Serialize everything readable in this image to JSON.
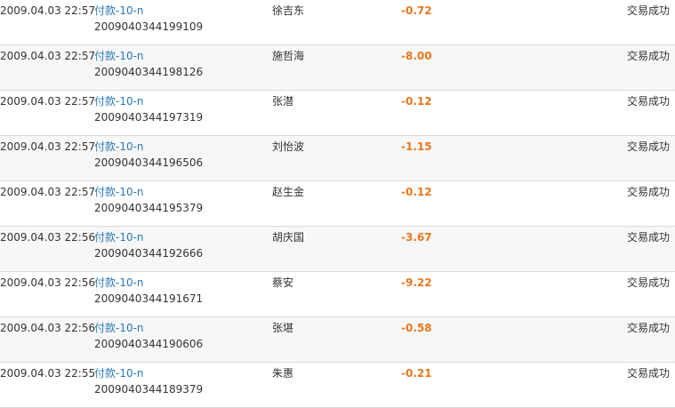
{
  "colors": {
    "link": "#2a79b4",
    "amount": "#e8771e",
    "row_alt_background": "#f7f7f7",
    "divider": "#d9d9d9"
  },
  "transactions": [
    {
      "time": "2009.04.03 22:57",
      "title": "付款-10-n",
      "serial": "2009040344199109",
      "name": "徐吉东",
      "amount": "-0.72",
      "status": "交易成功"
    },
    {
      "time": "2009.04.03 22:57",
      "title": "付款-10-n",
      "serial": "2009040344198126",
      "name": "施哲海",
      "amount": "-8.00",
      "status": "交易成功"
    },
    {
      "time": "2009.04.03 22:57",
      "title": "付款-10-n",
      "serial": "2009040344197319",
      "name": "张潜",
      "amount": "-0.12",
      "status": "交易成功"
    },
    {
      "time": "2009.04.03 22:57",
      "title": "付款-10-n",
      "serial": "2009040344196506",
      "name": "刘怡波",
      "amount": "-1.15",
      "status": "交易成功"
    },
    {
      "time": "2009.04.03 22:57",
      "title": "付款-10-n",
      "serial": "2009040344195379",
      "name": "赵生金",
      "amount": "-0.12",
      "status": "交易成功"
    },
    {
      "time": "2009.04.03 22:56",
      "title": "付款-10-n",
      "serial": "2009040344192666",
      "name": "胡庆国",
      "amount": "-3.67",
      "status": "交易成功"
    },
    {
      "time": "2009.04.03 22:56",
      "title": "付款-10-n",
      "serial": "2009040344191671",
      "name": "蔡安",
      "amount": "-9.22",
      "status": "交易成功"
    },
    {
      "time": "2009.04.03 22:56",
      "title": "付款-10-n",
      "serial": "2009040344190606",
      "name": "张堪",
      "amount": "-0.58",
      "status": "交易成功"
    },
    {
      "time": "2009.04.03 22:55",
      "title": "付款-10-n",
      "serial": "2009040344189379",
      "name": "朱惠",
      "amount": "-0.21",
      "status": "交易成功"
    }
  ]
}
